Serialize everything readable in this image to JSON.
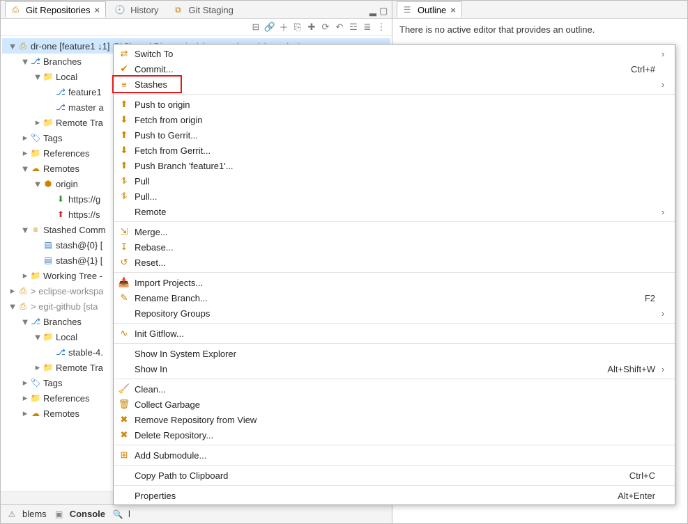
{
  "tabs_left": [
    {
      "label": "Git Repositories",
      "active": true,
      "closeable": true
    },
    {
      "label": "History",
      "active": false,
      "closeable": false
    },
    {
      "label": "Git Staging",
      "active": false,
      "closeable": false
    }
  ],
  "tabs_right": [
    {
      "label": "Outline",
      "active": true,
      "closeable": true
    }
  ],
  "outline_message": "There is no active editor that provides an outline.",
  "toolbar_icons": [
    "collapse-all-icon",
    "link-with-selection-icon",
    "add-repo-icon",
    "clone-repo-icon",
    "create-repo-icon",
    "refresh-icon",
    "undo-icon",
    "hierarchical-icon",
    "flat-icon",
    "view-menu-icon"
  ],
  "tree": [
    {
      "depth": 0,
      "tw": "▼",
      "icon": "git-repo-icon",
      "iclass": "c-gold",
      "label": "dr-one [feature1 ↓1]",
      "selected": true,
      "extra_grey": "D\\Closed Directories\\dr-one-release\\dr-one\\.git"
    },
    {
      "depth": 1,
      "tw": "▼",
      "icon": "branches-icon",
      "iclass": "c-blue",
      "label": "Branches"
    },
    {
      "depth": 2,
      "tw": "▼",
      "icon": "folder-icon",
      "iclass": "c-folder",
      "label": "Local"
    },
    {
      "depth": 3,
      "tw": "",
      "icon": "branch-checked-icon",
      "iclass": "c-blue",
      "label": "feature1"
    },
    {
      "depth": 3,
      "tw": "",
      "icon": "branch-icon",
      "iclass": "c-blue",
      "label": "master a"
    },
    {
      "depth": 2,
      "tw": "▸",
      "icon": "folder-icon",
      "iclass": "c-folder",
      "label": "Remote Tra"
    },
    {
      "depth": 1,
      "tw": "▸",
      "icon": "tags-icon",
      "iclass": "c-blue",
      "label": "Tags"
    },
    {
      "depth": 1,
      "tw": "▸",
      "icon": "folder-icon",
      "iclass": "c-folder",
      "label": "References"
    },
    {
      "depth": 1,
      "tw": "▼",
      "icon": "remotes-icon",
      "iclass": "c-gold",
      "label": "Remotes"
    },
    {
      "depth": 2,
      "tw": "▼",
      "icon": "remote-icon",
      "iclass": "c-gold",
      "label": "origin"
    },
    {
      "depth": 3,
      "tw": "",
      "icon": "remote-fetch-icon",
      "iclass": "c-green",
      "label": "https://g"
    },
    {
      "depth": 3,
      "tw": "",
      "icon": "remote-push-icon",
      "iclass": "c-red",
      "label": "https://s"
    },
    {
      "depth": 1,
      "tw": "▼",
      "icon": "stash-icon",
      "iclass": "c-gold",
      "label": "Stashed Comm"
    },
    {
      "depth": 2,
      "tw": "",
      "icon": "stash-entry-icon",
      "iclass": "c-blue",
      "label": "stash@{0} ["
    },
    {
      "depth": 2,
      "tw": "",
      "icon": "stash-entry-icon",
      "iclass": "c-blue",
      "label": "stash@{1} ["
    },
    {
      "depth": 1,
      "tw": "▸",
      "icon": "folder-icon",
      "iclass": "c-folder",
      "label": "Working Tree -"
    },
    {
      "depth": 0,
      "tw": "▸",
      "icon": "git-repo-icon",
      "iclass": "c-gold",
      "label": "> eclipse-workspa",
      "grey_label": true
    },
    {
      "depth": 0,
      "tw": "▼",
      "icon": "git-repo-icon",
      "iclass": "c-gold",
      "label": "> egit-github [sta",
      "grey_label": true
    },
    {
      "depth": 1,
      "tw": "▼",
      "icon": "branches-icon",
      "iclass": "c-blue",
      "label": "Branches"
    },
    {
      "depth": 2,
      "tw": "▼",
      "icon": "folder-icon",
      "iclass": "c-folder",
      "label": "Local"
    },
    {
      "depth": 3,
      "tw": "",
      "icon": "branch-checked-icon",
      "iclass": "c-blue",
      "label": "stable-4."
    },
    {
      "depth": 2,
      "tw": "▸",
      "icon": "folder-icon",
      "iclass": "c-folder",
      "label": "Remote Tra"
    },
    {
      "depth": 1,
      "tw": "▸",
      "icon": "tags-icon",
      "iclass": "c-blue",
      "label": "Tags"
    },
    {
      "depth": 1,
      "tw": "▸",
      "icon": "folder-icon",
      "iclass": "c-folder",
      "label": "References"
    },
    {
      "depth": 1,
      "tw": "▸",
      "icon": "remotes-icon",
      "iclass": "c-gold",
      "label": "Remotes"
    }
  ],
  "bottom_tabs": [
    {
      "label": "blems",
      "bold": false
    },
    {
      "label": "Console",
      "bold": true
    },
    {
      "label": "l",
      "bold": false
    }
  ],
  "context_menu": [
    {
      "type": "item",
      "icon": "switch-to-icon",
      "iclass": "c-blue",
      "label": "Switch To",
      "submenu": true
    },
    {
      "type": "item",
      "icon": "commit-icon",
      "iclass": "c-gold",
      "label": "Commit...",
      "accel": "Ctrl+#"
    },
    {
      "type": "item",
      "icon": "stash-icon",
      "iclass": "c-gold",
      "label": "Stashes",
      "submenu": true,
      "highlight": true
    },
    {
      "type": "sep"
    },
    {
      "type": "item",
      "icon": "push-icon",
      "iclass": "c-gold",
      "label": "Push to origin"
    },
    {
      "type": "item",
      "icon": "fetch-icon",
      "iclass": "c-gold",
      "label": "Fetch from origin"
    },
    {
      "type": "item",
      "icon": "push-icon",
      "iclass": "c-gold",
      "label": "Push to Gerrit..."
    },
    {
      "type": "item",
      "icon": "fetch-icon",
      "iclass": "c-gold",
      "label": "Fetch from Gerrit..."
    },
    {
      "type": "item",
      "icon": "push-branch-icon",
      "iclass": "c-gold",
      "label": "Push Branch 'feature1'..."
    },
    {
      "type": "item",
      "icon": "pull-icon",
      "iclass": "c-gold",
      "label": "Pull"
    },
    {
      "type": "item",
      "icon": "pull-icon",
      "iclass": "c-gold",
      "label": "Pull..."
    },
    {
      "type": "item",
      "icon": "",
      "iclass": "",
      "label": "Remote",
      "submenu": true
    },
    {
      "type": "sep"
    },
    {
      "type": "item",
      "icon": "merge-icon",
      "iclass": "c-green",
      "label": "Merge..."
    },
    {
      "type": "item",
      "icon": "rebase-icon",
      "iclass": "c-green",
      "label": "Rebase..."
    },
    {
      "type": "item",
      "icon": "reset-icon",
      "iclass": "c-gold",
      "label": "Reset..."
    },
    {
      "type": "sep"
    },
    {
      "type": "item",
      "icon": "import-icon",
      "iclass": "c-gold",
      "label": "Import Projects..."
    },
    {
      "type": "item",
      "icon": "rename-icon",
      "iclass": "c-grey",
      "label": "Rename Branch...",
      "accel": "F2"
    },
    {
      "type": "item",
      "icon": "",
      "iclass": "",
      "label": "Repository Groups",
      "submenu": true
    },
    {
      "type": "sep"
    },
    {
      "type": "item",
      "icon": "gitflow-icon",
      "iclass": "c-blue",
      "label": "Init Gitflow..."
    },
    {
      "type": "sep"
    },
    {
      "type": "item",
      "icon": "",
      "iclass": "",
      "label": "Show In System Explorer"
    },
    {
      "type": "item",
      "icon": "",
      "iclass": "",
      "label": "Show In",
      "accel": "Alt+Shift+W",
      "submenu": true
    },
    {
      "type": "sep"
    },
    {
      "type": "item",
      "icon": "clean-icon",
      "iclass": "c-gold",
      "label": "Clean..."
    },
    {
      "type": "item",
      "icon": "trash-icon",
      "iclass": "c-grey",
      "label": "Collect Garbage"
    },
    {
      "type": "item",
      "icon": "remove-icon",
      "iclass": "c-grey",
      "label": "Remove Repository from View"
    },
    {
      "type": "item",
      "icon": "delete-icon",
      "iclass": "c-red",
      "label": "Delete Repository..."
    },
    {
      "type": "sep"
    },
    {
      "type": "item",
      "icon": "submodule-icon",
      "iclass": "c-gold",
      "label": "Add Submodule..."
    },
    {
      "type": "sep"
    },
    {
      "type": "item",
      "icon": "",
      "iclass": "",
      "label": "Copy Path to Clipboard",
      "accel": "Ctrl+C"
    },
    {
      "type": "sep"
    },
    {
      "type": "item",
      "icon": "",
      "iclass": "",
      "label": "Properties",
      "accel": "Alt+Enter"
    }
  ],
  "icon_glyphs": {
    "git-repo-icon": "⎙",
    "branches-icon": "⎇",
    "folder-icon": "📁",
    "branch-icon": "⎇",
    "branch-checked-icon": "⎇",
    "tags-icon": "🏷",
    "remotes-icon": "☁",
    "remote-icon": "⬢",
    "remote-fetch-icon": "⬇",
    "remote-push-icon": "⬆",
    "stash-icon": "≡",
    "stash-entry-icon": "▤",
    "switch-to-icon": "⇄",
    "commit-icon": "✔",
    "push-icon": "⬆",
    "fetch-icon": "⬇",
    "push-branch-icon": "⬆",
    "pull-icon": "⥮",
    "merge-icon": "⇲",
    "rebase-icon": "↧",
    "reset-icon": "↺",
    "import-icon": "📥",
    "rename-icon": "✎",
    "gitflow-icon": "∿",
    "clean-icon": "🧹",
    "trash-icon": "🗑",
    "remove-icon": "✖",
    "delete-icon": "✖",
    "submodule-icon": "⊞",
    "history-icon": "🕘",
    "staging-icon": "⧉",
    "outline-icon": "☰",
    "collapse-all-icon": "⊟",
    "link-with-selection-icon": "🔗",
    "add-repo-icon": "＋",
    "clone-repo-icon": "⎘",
    "create-repo-icon": "✚",
    "refresh-icon": "⟳",
    "undo-icon": "↶",
    "hierarchical-icon": "☲",
    "flat-icon": "≣",
    "view-menu-icon": "⋮",
    "minimize-icon": "▂",
    "maximize-icon": "▢",
    "problems-icon": "⚠",
    "console-icon": "▣",
    "search-icon": "🔍"
  }
}
